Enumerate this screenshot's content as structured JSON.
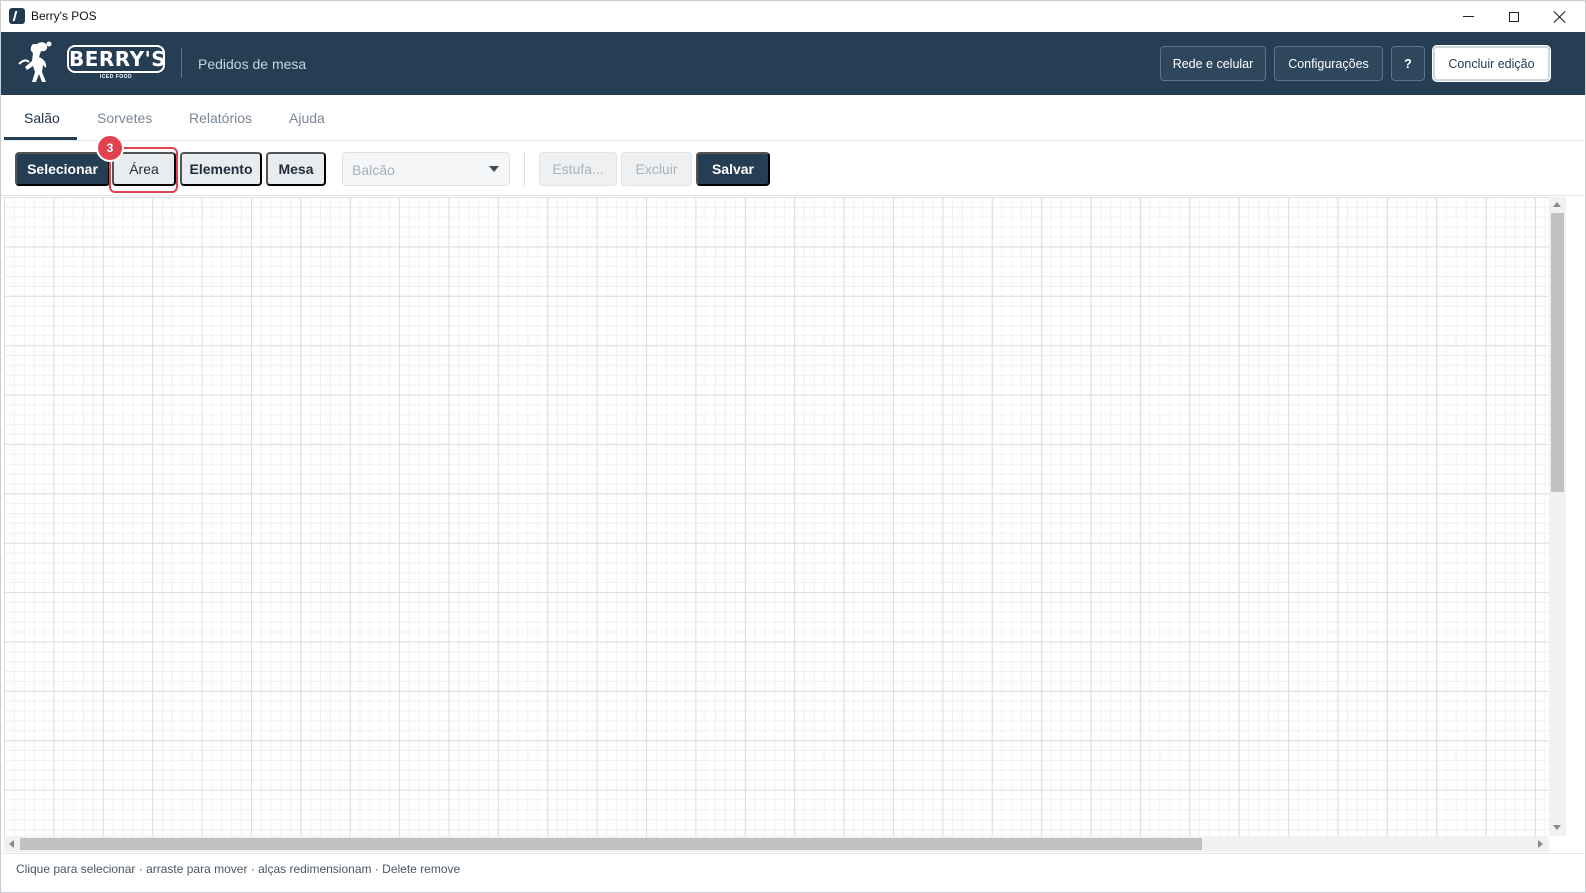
{
  "window": {
    "title": "Berry's POS"
  },
  "header": {
    "logo_text": "BERRY'S",
    "logo_subtext": "ICED FOOD",
    "subtitle": "Pedidos de mesa",
    "buttons": {
      "network": "Rede e celular",
      "settings": "Configurações",
      "help": "?",
      "finish_edit": "Concluir edição"
    }
  },
  "tabs": [
    {
      "label": "Salão",
      "active": true
    },
    {
      "label": "Sorvetes",
      "active": false
    },
    {
      "label": "Relatórios",
      "active": false
    },
    {
      "label": "Ajuda",
      "active": false
    }
  ],
  "toolbar": {
    "select_label": "Selecionar",
    "area_label": "Área",
    "element_label": "Elemento",
    "table_label": "Mesa",
    "dropdown_value": "Balcão",
    "estufa_label": "Estufa...",
    "delete_label": "Excluir",
    "save_label": "Salvar",
    "step_badge": "3"
  },
  "status": {
    "hint": "Clique para selecionar · arraste para mover · alças redimensionam · Delete remove"
  },
  "colors": {
    "header_bg": "#253e54",
    "accent": "#253e54",
    "highlight": "#e0424f"
  }
}
